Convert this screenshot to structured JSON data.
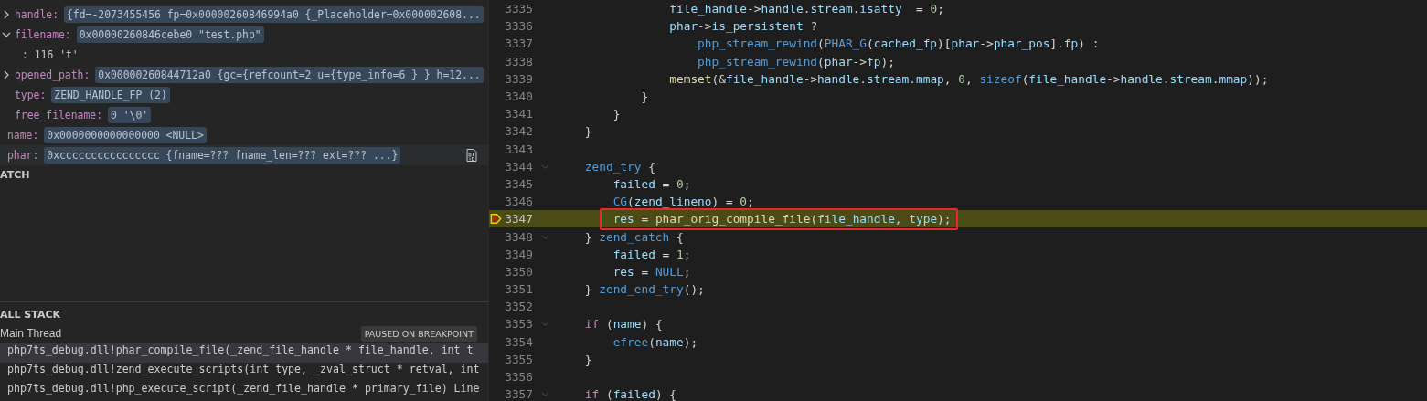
{
  "variables": [
    {
      "children": [
        {
          "name": "handle:",
          "value": "{fd=-2073455456 fp=0x00000260846994a0 {_Placeholder=0x000002608...",
          "expandable": true,
          "expanded": false,
          "selected": false
        },
        {
          "name": "filename:",
          "value": "0x00000260846cebe0 \"test.php\"",
          "expandable": true,
          "expanded": true,
          "selected": false,
          "children": [
            {
              "text": ": 116 't'"
            }
          ]
        },
        {
          "name": "opened_path:",
          "value": "0x00000260844712a0 {gc={refcount=2 u={type_info=6 } } h=12...",
          "expandable": true,
          "expanded": false,
          "selected": false
        },
        {
          "name": "type:",
          "value": "ZEND_HANDLE_FP (2)",
          "expandable": false,
          "selected": false
        },
        {
          "name": "free_filename:",
          "value": "0 '\\0'",
          "expandable": false,
          "selected": false
        }
      ]
    },
    {
      "name": "name:",
      "value": "0x0000000000000000 <NULL>",
      "expandable": false,
      "selected": false
    },
    {
      "name": "phar:",
      "value": "0xcccccccccccccccc {fname=??? fname_len=??? ext=??? ...}",
      "expandable": false,
      "selected": true
    }
  ],
  "watch": {
    "title": "ATCH"
  },
  "call_stack": {
    "title": "ALL STACK",
    "thread": "Main Thread",
    "badge": "PAUSED ON BREAKPOINT",
    "frames": [
      {
        "text": "php7ts_debug.dll!phar_compile_file(_zend_file_handle * file_handle, int t",
        "selected": true
      },
      {
        "text": "php7ts_debug.dll!zend_execute_scripts(int type, _zval_struct * retval, int",
        "selected": false
      },
      {
        "text": "php7ts_debug.dll!php_execute_script(_zend_file_handle * primary_file) Line",
        "selected": false
      }
    ]
  },
  "editor": {
    "lines": [
      {
        "number": "3335",
        "foldable": false,
        "current": false,
        "breakpoint": false,
        "boxed": false,
        "tokens": [
          {
            "text": "                file_handle",
            "kind": "v"
          },
          {
            "text": "->",
            "kind": "p"
          },
          {
            "text": "handle",
            "kind": "v"
          },
          {
            "text": ".",
            "kind": "p"
          },
          {
            "text": "stream",
            "kind": "v"
          },
          {
            "text": ".",
            "kind": "p"
          },
          {
            "text": "isatty",
            "kind": "v"
          },
          {
            "text": "  = ",
            "kind": "p"
          },
          {
            "text": "0",
            "kind": "n"
          },
          {
            "text": ";",
            "kind": "p"
          }
        ]
      },
      {
        "number": "3336",
        "foldable": false,
        "current": false,
        "breakpoint": false,
        "boxed": false,
        "tokens": [
          {
            "text": "                phar",
            "kind": "v"
          },
          {
            "text": "->",
            "kind": "p"
          },
          {
            "text": "is_persistent",
            "kind": "v"
          },
          {
            "text": " ?",
            "kind": "p"
          }
        ]
      },
      {
        "number": "3337",
        "foldable": false,
        "current": false,
        "breakpoint": false,
        "boxed": false,
        "tokens": [
          {
            "text": "                    php_stream_rewind",
            "kind": "m"
          },
          {
            "text": "(",
            "kind": "p"
          },
          {
            "text": "PHAR_G",
            "kind": "m"
          },
          {
            "text": "(",
            "kind": "p"
          },
          {
            "text": "cached_fp",
            "kind": "v"
          },
          {
            "text": ")[",
            "kind": "p"
          },
          {
            "text": "phar",
            "kind": "v"
          },
          {
            "text": "->",
            "kind": "p"
          },
          {
            "text": "phar_pos",
            "kind": "v"
          },
          {
            "text": "].",
            "kind": "p"
          },
          {
            "text": "fp",
            "kind": "v"
          },
          {
            "text": ") :",
            "kind": "p"
          }
        ]
      },
      {
        "number": "3338",
        "foldable": false,
        "current": false,
        "breakpoint": false,
        "boxed": false,
        "tokens": [
          {
            "text": "                    php_stream_rewind",
            "kind": "m"
          },
          {
            "text": "(",
            "kind": "p"
          },
          {
            "text": "phar",
            "kind": "v"
          },
          {
            "text": "->",
            "kind": "p"
          },
          {
            "text": "fp",
            "kind": "v"
          },
          {
            "text": ");",
            "kind": "p"
          }
        ]
      },
      {
        "number": "3339",
        "foldable": false,
        "current": false,
        "breakpoint": false,
        "boxed": false,
        "tokens": [
          {
            "text": "                memset",
            "kind": "f"
          },
          {
            "text": "(&",
            "kind": "p"
          },
          {
            "text": "file_handle",
            "kind": "v"
          },
          {
            "text": "->",
            "kind": "p"
          },
          {
            "text": "handle",
            "kind": "v"
          },
          {
            "text": ".",
            "kind": "p"
          },
          {
            "text": "stream",
            "kind": "v"
          },
          {
            "text": ".",
            "kind": "p"
          },
          {
            "text": "mmap",
            "kind": "v"
          },
          {
            "text": ", ",
            "kind": "p"
          },
          {
            "text": "0",
            "kind": "n"
          },
          {
            "text": ", ",
            "kind": "p"
          },
          {
            "text": "sizeof",
            "kind": "m"
          },
          {
            "text": "(",
            "kind": "p"
          },
          {
            "text": "file_handle",
            "kind": "v"
          },
          {
            "text": "->",
            "kind": "p"
          },
          {
            "text": "handle",
            "kind": "v"
          },
          {
            "text": ".",
            "kind": "p"
          },
          {
            "text": "stream",
            "kind": "v"
          },
          {
            "text": ".",
            "kind": "p"
          },
          {
            "text": "mmap",
            "kind": "v"
          },
          {
            "text": "));",
            "kind": "p"
          }
        ]
      },
      {
        "number": "3340",
        "foldable": false,
        "current": false,
        "breakpoint": false,
        "boxed": false,
        "tokens": [
          {
            "text": "            }",
            "kind": "p"
          }
        ]
      },
      {
        "number": "3341",
        "foldable": false,
        "current": false,
        "breakpoint": false,
        "boxed": false,
        "tokens": [
          {
            "text": "        }",
            "kind": "p"
          }
        ]
      },
      {
        "number": "3342",
        "foldable": false,
        "current": false,
        "breakpoint": false,
        "boxed": false,
        "tokens": [
          {
            "text": "    }",
            "kind": "p"
          }
        ]
      },
      {
        "number": "3343",
        "foldable": false,
        "current": false,
        "breakpoint": false,
        "boxed": false
      },
      {
        "number": "3344",
        "foldable": true,
        "current": false,
        "breakpoint": false,
        "boxed": false,
        "tokens": [
          {
            "text": "    zend_try",
            "kind": "m"
          },
          {
            "text": " {",
            "kind": "p"
          }
        ]
      },
      {
        "number": "3345",
        "foldable": false,
        "current": false,
        "breakpoint": false,
        "boxed": false,
        "tokens": [
          {
            "text": "        failed",
            "kind": "v"
          },
          {
            "text": " = ",
            "kind": "p"
          },
          {
            "text": "0",
            "kind": "n"
          },
          {
            "text": ";",
            "kind": "p"
          }
        ]
      },
      {
        "number": "3346",
        "foldable": false,
        "current": false,
        "breakpoint": false,
        "boxed": false,
        "tokens": [
          {
            "text": "        CG",
            "kind": "m"
          },
          {
            "text": "(",
            "kind": "p"
          },
          {
            "text": "zend_lineno",
            "kind": "v"
          },
          {
            "text": ") = ",
            "kind": "p"
          },
          {
            "text": "0",
            "kind": "n"
          },
          {
            "text": ";",
            "kind": "p"
          }
        ]
      },
      {
        "number": "3347",
        "foldable": false,
        "current": true,
        "breakpoint": true,
        "boxed": true,
        "tokens": [
          {
            "text": "        res",
            "kind": "v"
          },
          {
            "text": " = ",
            "kind": "p"
          },
          {
            "text": "phar_orig_compile_file",
            "kind": "f"
          },
          {
            "text": "(",
            "kind": "p"
          },
          {
            "text": "file_handle",
            "kind": "v"
          },
          {
            "text": ", ",
            "kind": "p"
          },
          {
            "text": "type",
            "kind": "v"
          },
          {
            "text": ");",
            "kind": "p"
          }
        ]
      },
      {
        "number": "3348",
        "foldable": true,
        "current": false,
        "breakpoint": false,
        "boxed": false,
        "tokens": [
          {
            "text": "    } ",
            "kind": "p"
          },
          {
            "text": "zend_catch",
            "kind": "m"
          },
          {
            "text": " {",
            "kind": "p"
          }
        ]
      },
      {
        "number": "3349",
        "foldable": false,
        "current": false,
        "breakpoint": false,
        "boxed": false,
        "tokens": [
          {
            "text": "        failed",
            "kind": "v"
          },
          {
            "text": " = ",
            "kind": "p"
          },
          {
            "text": "1",
            "kind": "n"
          },
          {
            "text": ";",
            "kind": "p"
          }
        ]
      },
      {
        "number": "3350",
        "foldable": false,
        "current": false,
        "breakpoint": false,
        "boxed": false,
        "tokens": [
          {
            "text": "        res",
            "kind": "v"
          },
          {
            "text": " = ",
            "kind": "p"
          },
          {
            "text": "NULL",
            "kind": "m"
          },
          {
            "text": ";",
            "kind": "p"
          }
        ]
      },
      {
        "number": "3351",
        "foldable": false,
        "current": false,
        "breakpoint": false,
        "boxed": false,
        "tokens": [
          {
            "text": "    } ",
            "kind": "p"
          },
          {
            "text": "zend_end_try",
            "kind": "m"
          },
          {
            "text": "();",
            "kind": "p"
          }
        ]
      },
      {
        "number": "3352",
        "foldable": false,
        "current": false,
        "breakpoint": false,
        "boxed": false
      },
      {
        "number": "3353",
        "foldable": true,
        "current": false,
        "breakpoint": false,
        "boxed": false,
        "tokens": [
          {
            "text": "    if",
            "kind": "k"
          },
          {
            "text": " (",
            "kind": "p"
          },
          {
            "text": "name",
            "kind": "v"
          },
          {
            "text": ") {",
            "kind": "p"
          }
        ]
      },
      {
        "number": "3354",
        "foldable": false,
        "current": false,
        "breakpoint": false,
        "boxed": false,
        "tokens": [
          {
            "text": "        efree",
            "kind": "m"
          },
          {
            "text": "(",
            "kind": "p"
          },
          {
            "text": "name",
            "kind": "v"
          },
          {
            "text": ");",
            "kind": "p"
          }
        ]
      },
      {
        "number": "3355",
        "foldable": false,
        "current": false,
        "breakpoint": false,
        "boxed": false,
        "tokens": [
          {
            "text": "    }",
            "kind": "p"
          }
        ]
      },
      {
        "number": "3356",
        "foldable": false,
        "current": false,
        "breakpoint": false,
        "boxed": false
      },
      {
        "number": "3357",
        "foldable": true,
        "current": false,
        "breakpoint": false,
        "boxed": false,
        "tokens": [
          {
            "text": "    if",
            "kind": "k"
          },
          {
            "text": " (",
            "kind": "p"
          },
          {
            "text": "failed",
            "kind": "v"
          },
          {
            "text": ") {",
            "kind": "p"
          }
        ]
      }
    ]
  }
}
